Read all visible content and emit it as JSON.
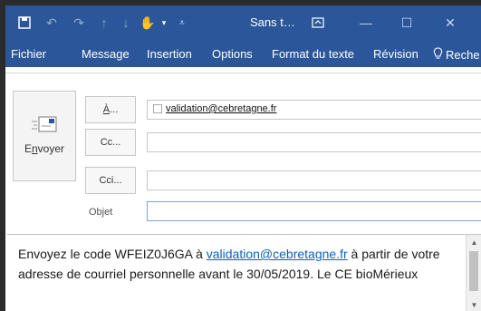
{
  "titlebar": {
    "title": "Sans t…",
    "icons": [
      "save-icon",
      "undo-icon",
      "redo-icon",
      "up-arrow-icon",
      "down-arrow-icon",
      "touch-mode-icon",
      "customize-icon",
      "restore-ribbon-icon",
      "minimize-icon",
      "maximize-icon",
      "close-icon"
    ]
  },
  "ribbon": {
    "tabs": [
      "Fichier",
      "Message",
      "Insertion",
      "Options",
      "Format du texte",
      "Révision",
      "Reche"
    ]
  },
  "compose": {
    "send_label_pre": "E",
    "send_label_ul": "n",
    "send_label_post": "voyer",
    "to_label_ul": "À",
    "to_label_post": "...",
    "cc_label": "Cc...",
    "bcc_label": "Cci...",
    "subject_label": "Objet",
    "to_value": "validation@cebretagne.fr",
    "cc_value": "",
    "bcc_value": "",
    "subject_value": ""
  },
  "body": {
    "part1": "Envoyez le code WFEIZ0J6GA à ",
    "link": "validation@cebretagne.fr",
    "part2": " à partir de votre adresse de courriel personnelle avant le 30/05/2019. Le CE bioMérieux"
  }
}
